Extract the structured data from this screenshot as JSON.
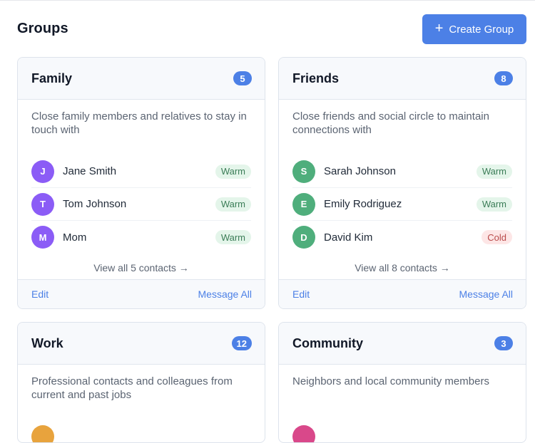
{
  "page": {
    "title": "Groups",
    "create_button": "Create Group",
    "create_icon": "plus-icon"
  },
  "groups": [
    {
      "name": "Family",
      "count": "5",
      "description": "Close family members and relatives to stay in touch with",
      "contacts": [
        {
          "initial": "J",
          "name": "Jane Smith",
          "status": "Warm",
          "avatar_color": "#8b5cf6"
        },
        {
          "initial": "T",
          "name": "Tom Johnson",
          "status": "Warm",
          "avatar_color": "#8b5cf6"
        },
        {
          "initial": "M",
          "name": "Mom",
          "status": "Warm",
          "avatar_color": "#8b5cf6"
        }
      ],
      "view_all": "View all 5 contacts →",
      "edit": "Edit",
      "message_all": "Message All"
    },
    {
      "name": "Friends",
      "count": "8",
      "description": "Close friends and social circle to maintain connections with",
      "contacts": [
        {
          "initial": "S",
          "name": "Sarah Johnson",
          "status": "Warm",
          "avatar_color": "#4fae7c"
        },
        {
          "initial": "E",
          "name": "Emily Rodriguez",
          "status": "Warm",
          "avatar_color": "#4fae7c"
        },
        {
          "initial": "D",
          "name": "David Kim",
          "status": "Cold",
          "avatar_color": "#4fae7c"
        }
      ],
      "view_all": "View all 8 contacts →",
      "edit": "Edit",
      "message_all": "Message All"
    },
    {
      "name": "Work",
      "count": "12",
      "description": "Professional contacts and colleagues from current and past jobs",
      "first_avatar_color": "#e8a33d"
    },
    {
      "name": "Community",
      "count": "3",
      "description": "Neighbors and local community members",
      "first_avatar_color": "#d9488a"
    }
  ],
  "colors": {
    "accent": "#4c80e6",
    "warm_bg": "#e4f5ea",
    "cold_bg": "#fde6e6"
  }
}
